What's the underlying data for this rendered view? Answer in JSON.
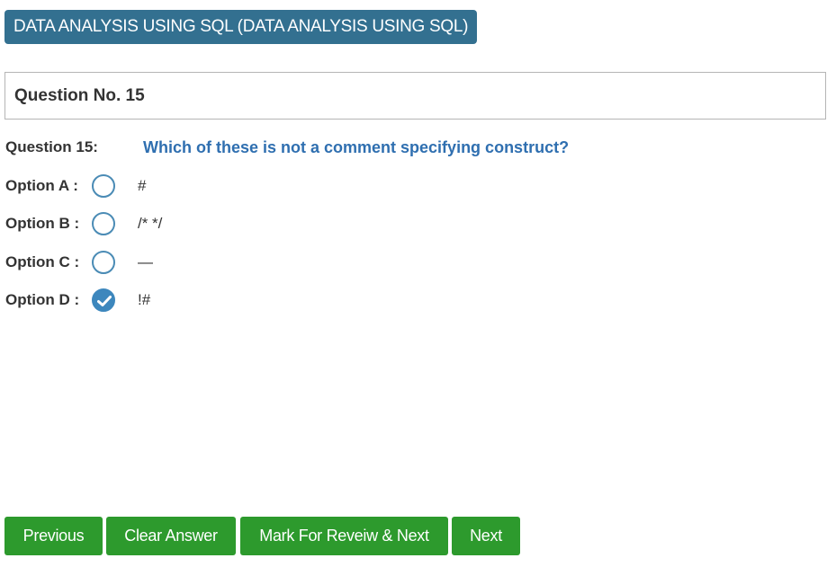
{
  "header": {
    "subject": "DATA ANALYSIS USING SQL (DATA ANALYSIS USING SQL)"
  },
  "question_panel": {
    "title": "Question No. 15"
  },
  "question": {
    "label": "Question 15:",
    "text": "Which of these is not a comment specifying construct?"
  },
  "options": [
    {
      "label": "Option A :",
      "text": "#",
      "selected": false
    },
    {
      "label": "Option B :",
      "text": "/* */",
      "selected": false
    },
    {
      "label": "Option C :",
      "text": "—",
      "selected": false
    },
    {
      "label": "Option D :",
      "text": "!#",
      "selected": true
    }
  ],
  "buttons": {
    "previous": "Previous",
    "clear": "Clear Answer",
    "mark_review_next": "Mark For Reveiw & Next",
    "next": "Next"
  },
  "colors": {
    "badge": "#337090",
    "question_text": "#2f6fb0",
    "radio": "#4a8bb5",
    "radio_checked": "#3d87bd",
    "button": "#2d9a2d"
  }
}
